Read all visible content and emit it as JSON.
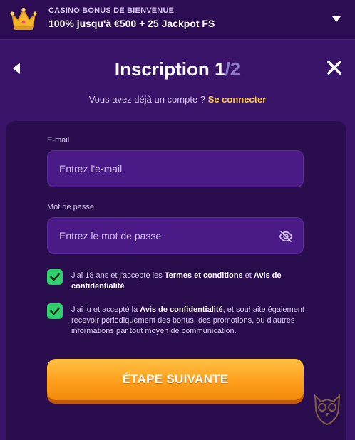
{
  "banner": {
    "subtitle": "CASINO BONUS DE BIENVENUE",
    "offer": "100% jusqu'à €500 + 25 Jackpot FS"
  },
  "header": {
    "title": "Inscription 1",
    "title_step_total": "/2",
    "already_account": "Vous avez déjà un compte ?",
    "login_link": "Se connecter"
  },
  "form": {
    "email": {
      "label": "E-mail",
      "placeholder": "Entrez l'e-mail",
      "value": ""
    },
    "password": {
      "label": "Mot de passe",
      "placeholder": "Entrez le mot de passe",
      "value": ""
    },
    "consent_terms": {
      "checked": true,
      "text_before": "J'ai 18 ans et j'accepte les ",
      "terms_link": "Termes et conditions",
      "text_and": " et ",
      "privacy_link": "Avis de confidentialité"
    },
    "consent_marketing": {
      "checked": true,
      "text_before": "J'ai lu et accepté la ",
      "privacy_link": "Avis de confidentialité",
      "text_after": ", et souhaite également recevoir périodiquement des bonus, des promotions, ou d'autres informations par tout moyen de communication."
    },
    "next_button": "ÉTAPE SUIVANTE"
  },
  "icons": {
    "banner": "crown-icon",
    "expand": "chevron-down-icon",
    "back": "back-arrow-icon",
    "close": "close-icon",
    "password_visibility": "eye-off-icon",
    "checkbox": "checkmark-icon",
    "brand": "owl-logo-icon"
  },
  "colors": {
    "background": "#3a1468",
    "panel": "#2a0d4d",
    "input": "#4a1a86",
    "accent_link": "#ffc93c",
    "checkbox": "#2fcf6b",
    "button": "#ff9f1c"
  }
}
